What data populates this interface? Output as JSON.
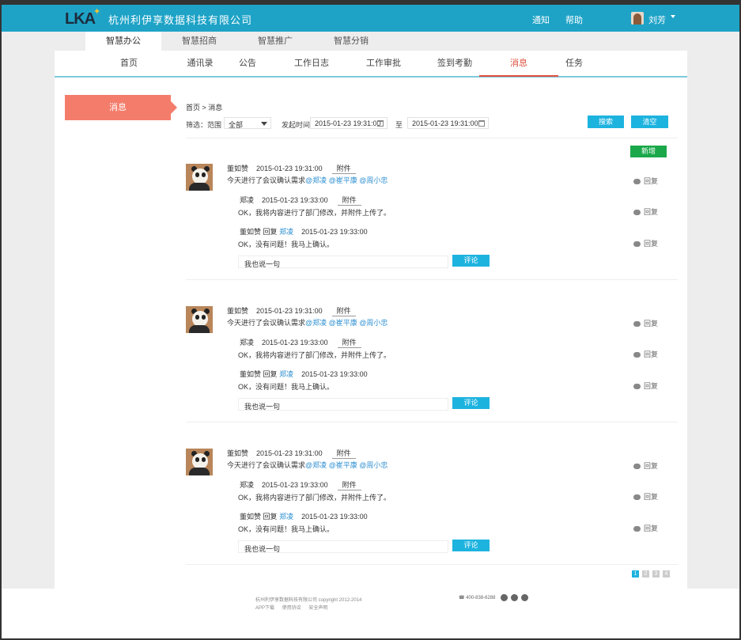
{
  "header": {
    "logo_text": "LKA",
    "company": "杭州利伊享数据科技有限公司",
    "notify": "通知",
    "help": "帮助",
    "user": "刘芳"
  },
  "main_tabs": [
    "智慧办公",
    "智慧招商",
    "智慧推广",
    "智慧分销"
  ],
  "subnav": [
    "首页",
    "通讯录",
    "公告",
    "工作日志",
    "工作审批",
    "签到考勤",
    "消息",
    "任务"
  ],
  "side_tag": "消息",
  "breadcrumb": "首页 > 消息",
  "filter": {
    "label": "筛选：范围",
    "scope": "全部",
    "time_label": "发起时间",
    "start": "2015-01-23 19:31:00",
    "to": "至",
    "end": "2015-01-23 19:31:00",
    "search": "搜索",
    "clear": "清空"
  },
  "add_button": "新增",
  "messages": [
    {
      "author": "董如赞",
      "time": "2015-01-23 19:31:00",
      "attach": "附件",
      "text": "今天进行了会议确认需求",
      "mentions": "@郑凌 @崔平康 @周小忠",
      "reply1": {
        "author": "郑凌",
        "time": "2015-01-23 19:33:00",
        "attach": "附件",
        "text": "OK，我将内容进行了部门修改，并附件上传了。"
      },
      "reply2": {
        "author": "董如赞",
        "verb": "回复",
        "target": "郑凌",
        "time": "2015-01-23 19:33:00",
        "text": "OK，没有问题！我马上确认。"
      },
      "reply_label": "回复",
      "placeholder": "我也说一句",
      "comment": "评论"
    },
    {
      "author": "董如赞",
      "time": "2015-01-23 19:31:00",
      "attach": "附件",
      "text": "今天进行了会议确认需求",
      "mentions": "@郑凌 @崔平康 @周小忠",
      "reply1": {
        "author": "郑凌",
        "time": "2015-01-23 19:33:00",
        "attach": "附件",
        "text": "OK，我将内容进行了部门修改，并附件上传了。"
      },
      "reply2": {
        "author": "董如赞",
        "verb": "回复",
        "target": "郑凌",
        "time": "2015-01-23 19:33:00",
        "text": "OK，没有问题！我马上确认。"
      },
      "reply_label": "回复",
      "placeholder": "我也说一句",
      "comment": "评论"
    },
    {
      "author": "董如赞",
      "time": "2015-01-23 19:31:00",
      "attach": "附件",
      "text": "今天进行了会议确认需求",
      "mentions": "@郑凌 @崔平康 @周小忠",
      "reply1": {
        "author": "郑凌",
        "time": "2015-01-23 19:33:00",
        "attach": "附件",
        "text": "OK，我将内容进行了部门修改，并附件上传了。"
      },
      "reply2": {
        "author": "董如赞",
        "verb": "回复",
        "target": "郑凌",
        "time": "2015-01-23 19:33:00",
        "text": "OK，没有问题！我马上确认。"
      },
      "reply_label": "回复",
      "placeholder": "我也说一句",
      "comment": "评论"
    }
  ],
  "pager": [
    "1",
    "2",
    "3",
    "4"
  ],
  "footer": {
    "copyright": "杭州利伊享数据科技有限公司  copyright  2012-2014",
    "links": [
      "APP下载",
      "使用协议",
      "安全声明"
    ],
    "phone": "400-838-6288"
  },
  "colors": {
    "brand": "#1ea3c7",
    "active": "#e0513f",
    "accent_btn": "#1db3df",
    "add_btn": "#1aa84a",
    "side_tag": "#f47c6b"
  }
}
